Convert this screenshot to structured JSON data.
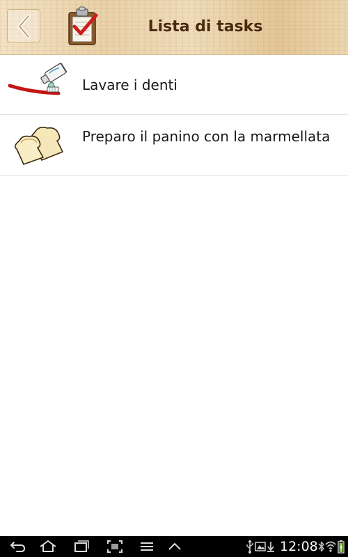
{
  "header": {
    "title": "Lista di tasks",
    "back_icon": "chevron-left-icon",
    "app_icon": "clipboard-check-icon"
  },
  "tasks": [
    {
      "label": "Lavare i denti",
      "icon": "toothbrush-icon"
    },
    {
      "label": "Preparo il panino con la marmellata",
      "icon": "bread-slices-icon"
    }
  ],
  "system_bar": {
    "time": "12:08",
    "nav_icons": [
      "back-icon",
      "home-icon",
      "recent-apps-icon",
      "screenshot-icon",
      "menu-icon",
      "up-chevron-icon"
    ],
    "status_icons": [
      "usb-icon",
      "gallery-icon",
      "download-icon",
      "bluetooth-icon",
      "wifi-icon",
      "battery-icon"
    ]
  },
  "colors": {
    "title_text": "#4b2a0c",
    "header_wood": "#e9d1a8",
    "check_red": "#d11a1a",
    "divider": "#e3e3e3",
    "system_bar": "#000000"
  }
}
